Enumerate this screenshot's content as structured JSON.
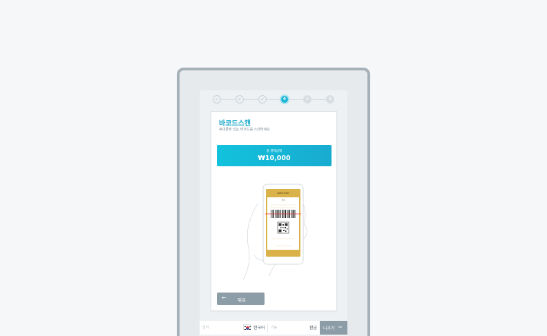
{
  "stepper": {
    "steps": [
      {
        "label": "",
        "state": "done"
      },
      {
        "label": "",
        "state": "done"
      },
      {
        "label": "",
        "state": "done"
      },
      {
        "label": "4",
        "state": "active"
      },
      {
        "label": "5",
        "state": "todo"
      },
      {
        "label": "6",
        "state": "todo"
      }
    ]
  },
  "card": {
    "title": "바코드스캔",
    "subtitle": "휴대폰에 있는 바코드를 스캔하세요",
    "amount_label": "총 결제금액",
    "amount_value": "₩10,000",
    "back_label": "뒤로",
    "back_icon": "arrow-left-icon"
  },
  "phone": {
    "header": "BARCODE",
    "sub": "결제"
  },
  "footer": {
    "language_label": "언어",
    "language_value": "한국어",
    "function_label": "기능",
    "function_value": "환급",
    "exit_label": "나가기",
    "exit_icon": "exit-icon"
  },
  "colors": {
    "accent": "#16a8c9",
    "button": "#8d9da8",
    "phone_gold": "#d9b24a"
  }
}
